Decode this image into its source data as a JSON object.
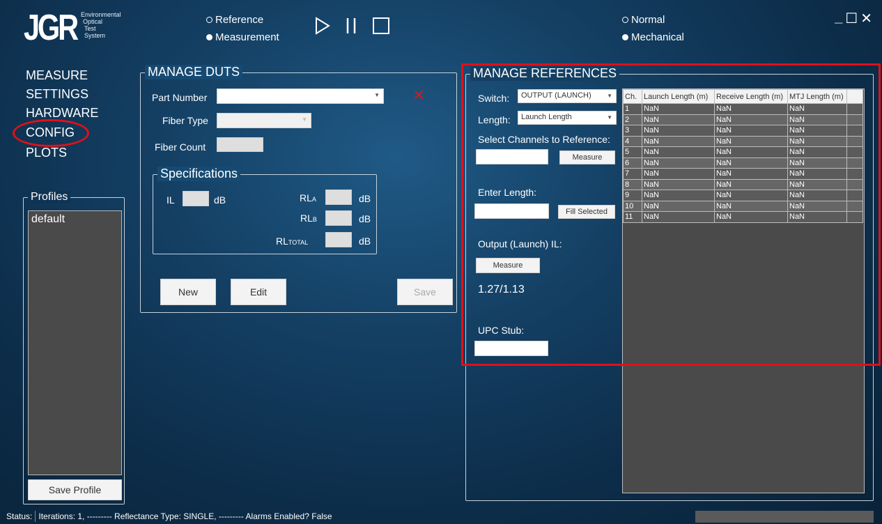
{
  "logo": {
    "text": "JGR",
    "subtitle_lines": [
      "Environmental",
      "Optical",
      "Test",
      "System"
    ]
  },
  "mode_radios": [
    {
      "label": "Reference",
      "selected": false
    },
    {
      "label": "Measurement",
      "selected": true
    }
  ],
  "test_radios": [
    {
      "label": "Normal",
      "selected": false
    },
    {
      "label": "Mechanical",
      "selected": true
    }
  ],
  "transport": {
    "icons": [
      "play-icon",
      "pause-icon",
      "stop-icon"
    ]
  },
  "window_controls": {
    "minimize": "_",
    "maximize": "☐",
    "close": "✕"
  },
  "nav": {
    "items": [
      "MEASURE",
      "SETTINGS",
      "HARDWARE",
      "CONFIG",
      "PLOTS"
    ],
    "active": "CONFIG"
  },
  "profiles": {
    "title": "Profiles",
    "items": [
      "default"
    ],
    "save_label": "Save Profile"
  },
  "manage_duts": {
    "title": "MANAGE DUTS",
    "part_number_label": "Part Number",
    "part_number_value": "",
    "fiber_type_label": "Fiber Type",
    "fiber_type_value": "",
    "fiber_count_label": "Fiber Count",
    "fiber_count_value": "",
    "clear_icon": "✕",
    "specs": {
      "title": "Specifications",
      "il_label": "IL",
      "rla_label": "RL",
      "rla_sub": "A",
      "rlb_label": "RL",
      "rlb_sub": "B",
      "rltotal_label": "RL",
      "rltotal_sub": "TOTAL",
      "unit": "dB"
    },
    "buttons": {
      "new": "New",
      "edit": "Edit",
      "save": "Save"
    }
  },
  "manage_references": {
    "title": "MANAGE REFERENCES",
    "switch_label": "Switch:",
    "switch_value": "OUTPUT (LAUNCH)",
    "length_label": "Length:",
    "length_value": "Launch Length",
    "select_channels_label": "Select Channels to Reference:",
    "select_channels_value": "",
    "measure_label": "Measure",
    "enter_length_label": "Enter Length:",
    "enter_length_value": "",
    "fill_selected_label": "Fill Selected",
    "output_il_label": "Output (Launch) IL:",
    "output_measure_label": "Measure",
    "il_value": "1.27/1.13",
    "upc_stub_label": "UPC Stub:",
    "upc_stub_value": ""
  },
  "ref_table": {
    "headers": [
      "Ch.",
      "Launch Length (m)",
      "Receive Length (m)",
      "MTJ Length (m)",
      ""
    ],
    "rows": [
      [
        "1",
        "NaN",
        "NaN",
        "NaN",
        ""
      ],
      [
        "2",
        "NaN",
        "NaN",
        "NaN",
        ""
      ],
      [
        "3",
        "NaN",
        "NaN",
        "NaN",
        ""
      ],
      [
        "4",
        "NaN",
        "NaN",
        "NaN",
        ""
      ],
      [
        "5",
        "NaN",
        "NaN",
        "NaN",
        ""
      ],
      [
        "6",
        "NaN",
        "NaN",
        "NaN",
        ""
      ],
      [
        "7",
        "NaN",
        "NaN",
        "NaN",
        ""
      ],
      [
        "8",
        "NaN",
        "NaN",
        "NaN",
        ""
      ],
      [
        "9",
        "NaN",
        "NaN",
        "NaN",
        ""
      ],
      [
        "10",
        "NaN",
        "NaN",
        "NaN",
        ""
      ],
      [
        "11",
        "NaN",
        "NaN",
        "NaN",
        ""
      ]
    ]
  },
  "status": {
    "label": "Status:",
    "text": "Iterations: 1, --------- Reflectance Type: SINGLE, --------- Alarms Enabled? False"
  },
  "colors": {
    "accent_red": "#e0101a",
    "background_dark": "#0c2c48",
    "list_gray": "#4a4a4a"
  }
}
